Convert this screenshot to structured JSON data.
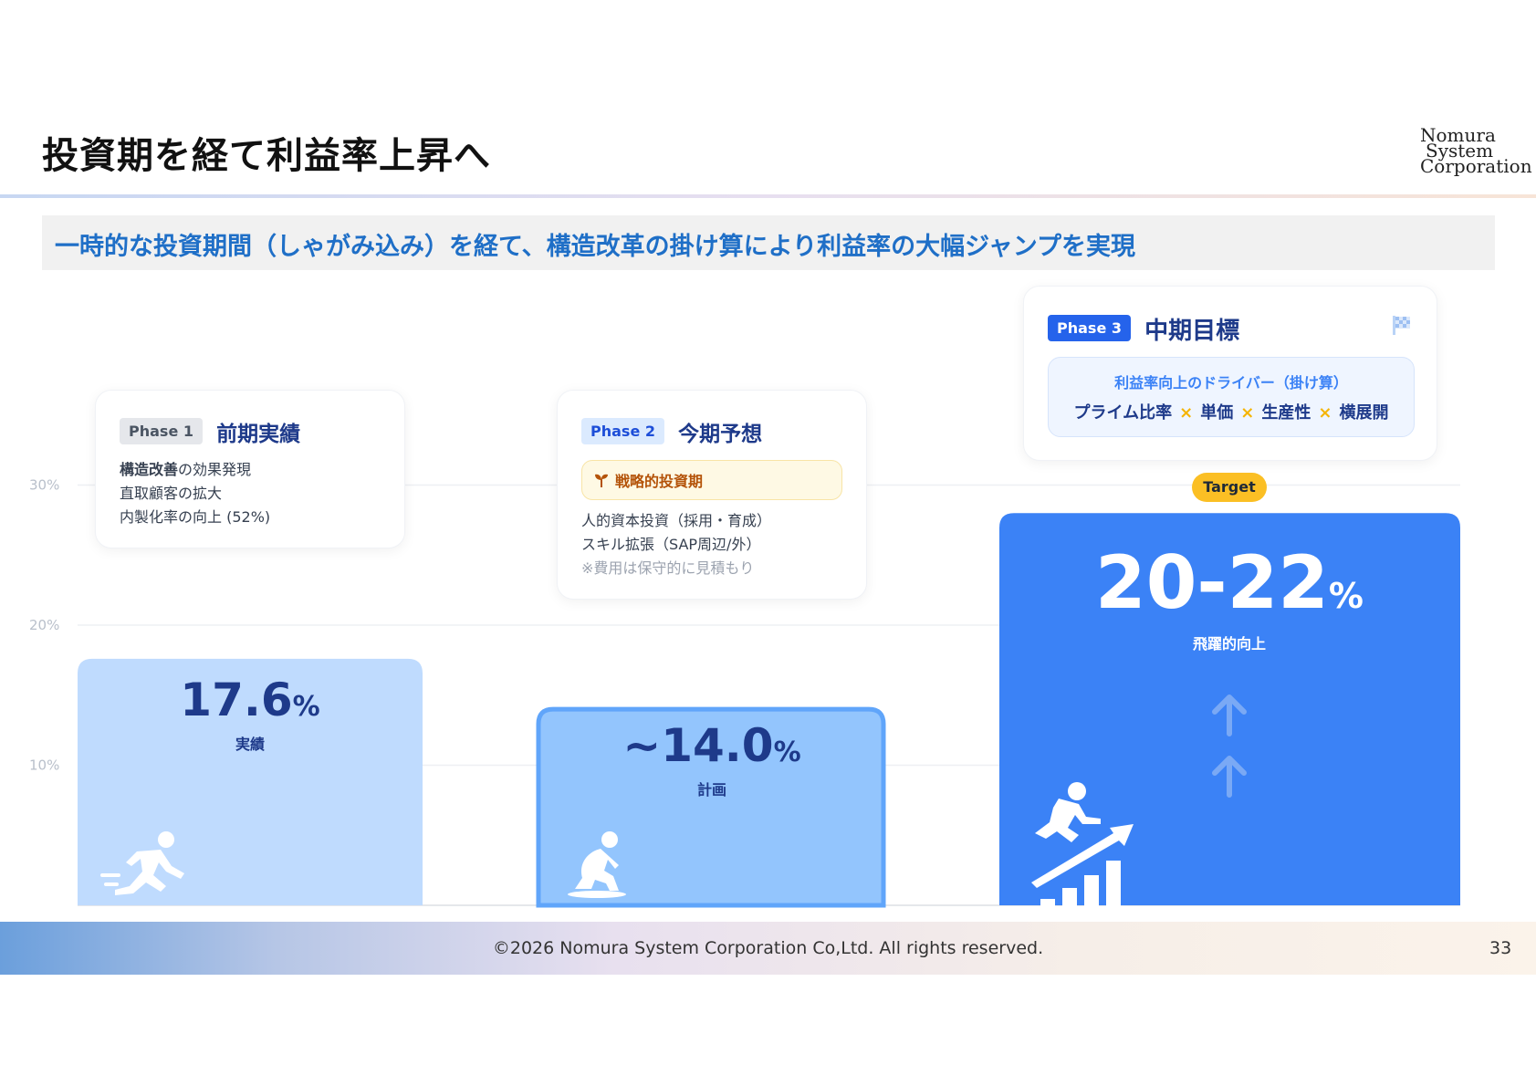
{
  "title": "投資期を経て利益率上昇へ",
  "logo_lines": [
    "Nomura",
    "System",
    "Corporation"
  ],
  "subtitle": "一時的な投資期間（しゃがみ込み）を経て、構造改革の掛け算により利益率の大幅ジャンプを実現",
  "phases": [
    {
      "tag": "Phase 1",
      "title": "前期実績",
      "lines": [
        {
          "strong": "構造改善",
          "rest": "の効果発現"
        },
        {
          "strong": "",
          "rest": "直取顧客の拡大"
        },
        {
          "strong": "",
          "rest": "内製化率の向上 (52%)"
        }
      ]
    },
    {
      "tag": "Phase 2",
      "title": "今期予想",
      "strategic": "戦略的投資期",
      "lines": [
        "人的資本投資（採用・育成）",
        "スキル拡張（SAP周辺/外）"
      ],
      "note": "※費用は保守的に見積もり"
    },
    {
      "tag": "Phase 3",
      "title": "中期目標",
      "driver_title": "利益率向上のドライバー（掛け算）",
      "drivers": [
        "プライム比率",
        "単価",
        "生産性",
        "横展開"
      ],
      "times_symbol": "×"
    }
  ],
  "target_badge": "Target",
  "colors": {
    "phase1_bar": "#bfdbfe",
    "phase2_bar": "#93c5fd",
    "phase2_border": "#60a5fa",
    "phase3_bar": "#3b82f6",
    "accent_dark": "#1e3a8a",
    "target": "#fbbf24"
  },
  "icons": [
    "running-person-icon",
    "crouching-person-icon",
    "jumping-growth-icon",
    "up-arrow-icon",
    "checkered-flag-icon",
    "sprout-icon"
  ],
  "chart_data": {
    "type": "bar",
    "categories": [
      "前期実績",
      "今期予想",
      "中期目標"
    ],
    "values": [
      17.6,
      14.0,
      28.0
    ],
    "value_labels": [
      {
        "value": "17.6",
        "unit": "%",
        "label": "実績"
      },
      {
        "value": "~14.0",
        "unit": "%",
        "label": "計画"
      },
      {
        "value": "20-22",
        "unit": "%",
        "label": "飛躍的向上"
      }
    ],
    "y_ticks": [
      "10%",
      "20%",
      "30%"
    ],
    "ylim": [
      0,
      30
    ],
    "grid": true
  },
  "footer": {
    "copyright": "©2026 Nomura System Corporation Co,Ltd. All rights reserved.",
    "page": "33"
  }
}
